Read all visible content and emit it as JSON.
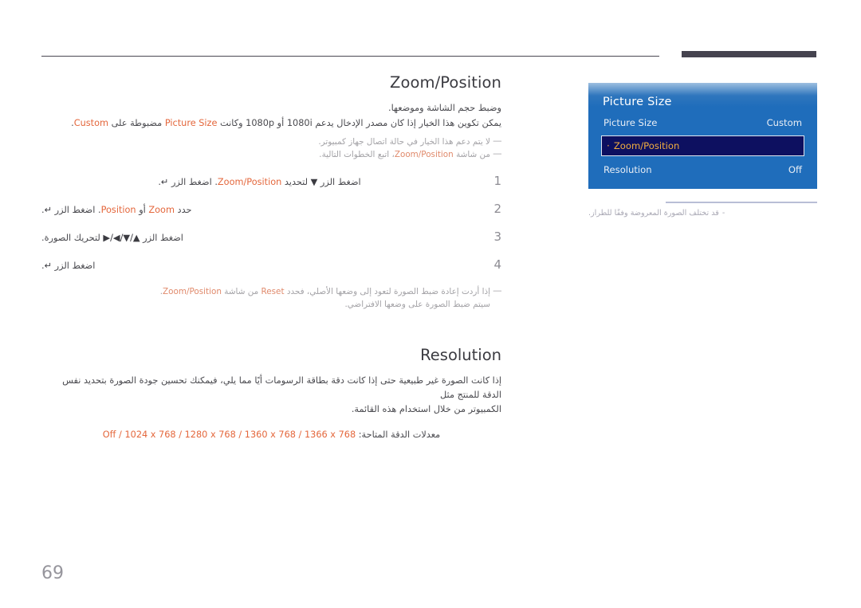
{
  "page": {
    "number": "69"
  },
  "sections": {
    "zoom_position": {
      "title": "Zoom/Position",
      "intro_line1": "وضبط حجم الشاشة وموضعها.",
      "intro_line2_a": "يمكن تكوين هذا الخيار إذا كان مصدر الإدخال يدعم 1080i أو 1080p وكانت ",
      "intro_line2_b": "Picture Size",
      "intro_line2_c": " مضبوطة على ",
      "intro_line2_d": "Custom",
      "intro_line2_e": ".",
      "note1": "لا يتم دعم هذا الخيار في حالة اتصال جهاز كمبيوتر.",
      "note2_a": "من شاشة ",
      "note2_b": "Zoom/Position",
      "note2_c": "، اتبع الخطوات التالية.",
      "steps": [
        {
          "num": "1",
          "a": "اضغط الزر ",
          "arrow": "▼",
          "b": " لتحديد ",
          "target": "Zoom/Position",
          "c": ". اضغط الزر ",
          "enter": "↵",
          "d": "."
        },
        {
          "num": "2",
          "a": "حدد ",
          "target": "Zoom",
          "b": " أو ",
          "target2": "Position",
          "c": ". اضغط الزر ",
          "enter": "↵",
          "d": "."
        },
        {
          "num": "3",
          "a": "اضغط الزر ",
          "arrow": "▲/▼/◀/▶",
          "b": " لتحريك الصورة."
        },
        {
          "num": "4",
          "a": "اضغط الزر ",
          "enter": "↵",
          "b": "."
        }
      ],
      "step_note_line1_a": "إذا أردت إعادة ضبط الصورة لتعود إلى وضعها الأصلي، فحدد ",
      "step_note_line1_b": "Reset",
      "step_note_line1_c": " من شاشة ",
      "step_note_line1_d": "Zoom/Position",
      "step_note_line1_e": ".",
      "step_note_line2": "سيتم ضبط الصورة على وضعها الافتراضي."
    },
    "resolution": {
      "title": "Resolution",
      "para_line1": "إذا كانت الصورة غير طبيعية حتى إذا كانت دقة بطاقة الرسومات أيًا مما يلي، فيمكنك تحسين جودة الصورة بتحديد نفس الدقة للمنتج مثل",
      "para_line2": "الكمبيوتر من خلال استخدام هذه القائمة.",
      "list_label": "معدلات الدقة المتاحة: ",
      "list_values": "Off / 1024 x 768 / 1280 x 768 / 1360 x 768 / 1366 x 768"
    }
  },
  "osd": {
    "title": "Picture Size",
    "rows": [
      {
        "label": "Picture Size",
        "value": "Custom",
        "selected": false
      },
      {
        "label": "Zoom/Position",
        "value": "",
        "selected": true
      },
      {
        "label": "Resolution",
        "value": "Off",
        "selected": false
      }
    ],
    "caption_dash": "-",
    "caption_text": "قد تختلف الصورة المعروضة وفقًا للطراز."
  },
  "colors": {
    "accent": "#e4673c",
    "osd_blue": "#1f6dbb",
    "osd_selected_bg": "#0d1060",
    "osd_selected_text": "#f2ae3f",
    "heading": "#3b3b41",
    "muted": "#a3a2a6"
  }
}
